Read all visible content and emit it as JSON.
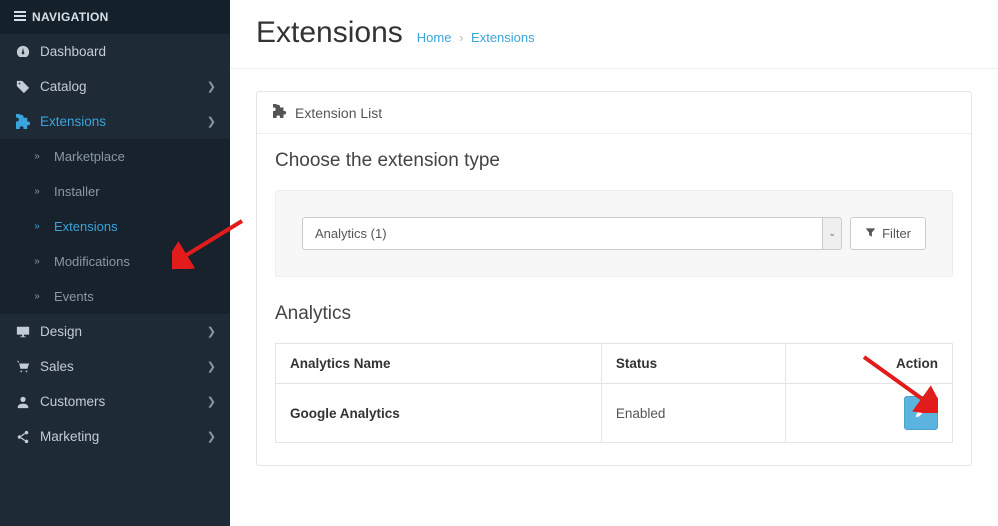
{
  "sidebar": {
    "header": "NAVIGATION",
    "items": [
      {
        "icon": "dashboard",
        "label": "Dashboard",
        "hasChildren": false
      },
      {
        "icon": "tag",
        "label": "Catalog",
        "hasChildren": true
      },
      {
        "icon": "puzzle",
        "label": "Extensions",
        "hasChildren": true,
        "active": true,
        "children": [
          {
            "label": "Marketplace"
          },
          {
            "label": "Installer"
          },
          {
            "label": "Extensions",
            "active": true
          },
          {
            "label": "Modifications"
          },
          {
            "label": "Events"
          }
        ]
      },
      {
        "icon": "desktop",
        "label": "Design",
        "hasChildren": true
      },
      {
        "icon": "cart",
        "label": "Sales",
        "hasChildren": true
      },
      {
        "icon": "user",
        "label": "Customers",
        "hasChildren": true
      },
      {
        "icon": "share",
        "label": "Marketing",
        "hasChildren": true
      }
    ]
  },
  "page": {
    "title": "Extensions",
    "breadcrumb": {
      "home": "Home",
      "current": "Extensions"
    }
  },
  "panel": {
    "title": "Extension List",
    "choose_title": "Choose the extension type",
    "select_value": "Analytics (1)",
    "filter_label": "Filter"
  },
  "analytics": {
    "section_title": "Analytics",
    "columns": {
      "name": "Analytics Name",
      "status": "Status",
      "action": "Action"
    },
    "rows": [
      {
        "name": "Google Analytics",
        "status": "Enabled"
      }
    ]
  }
}
